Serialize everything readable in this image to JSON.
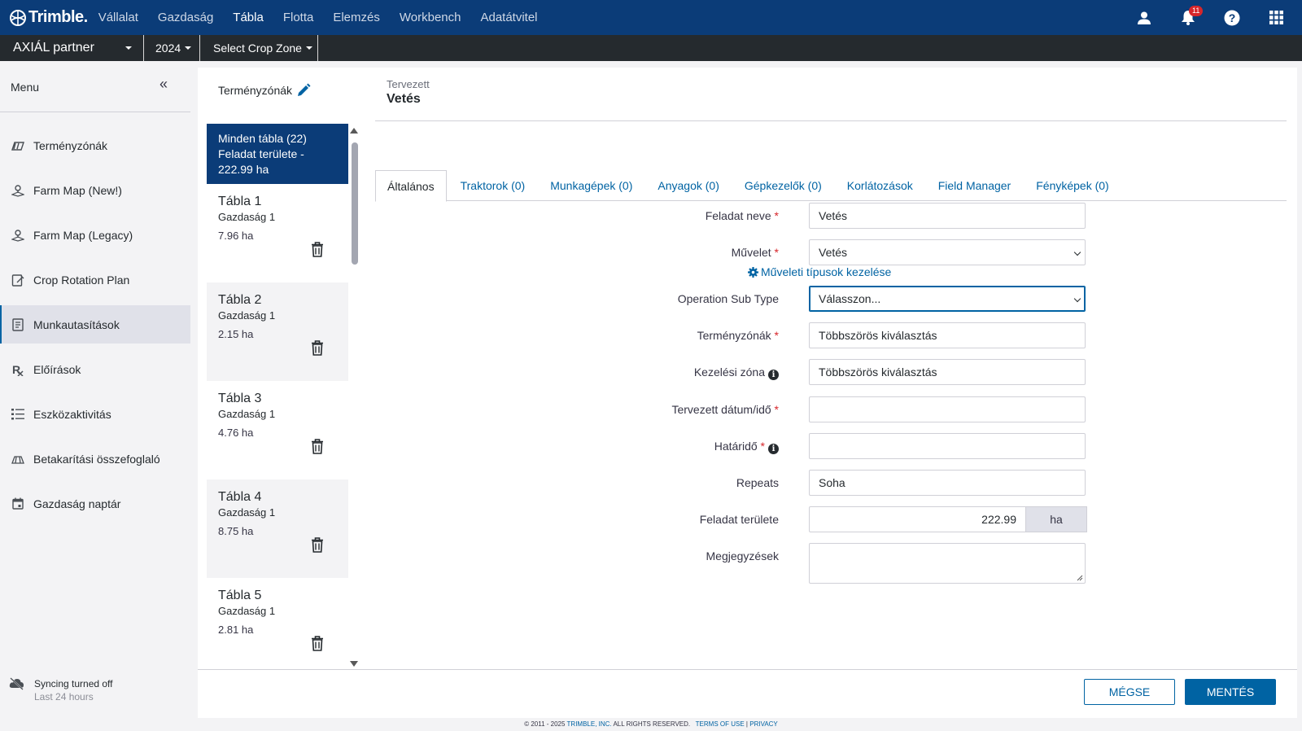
{
  "topnav": {
    "logo_text": "Trimble.",
    "items": [
      {
        "label": "Vállalat",
        "active": false
      },
      {
        "label": "Gazdaság",
        "active": false
      },
      {
        "label": "Tábla",
        "active": true
      },
      {
        "label": "Flotta",
        "active": false
      },
      {
        "label": "Elemzés",
        "active": false
      },
      {
        "label": "Workbench",
        "active": false
      },
      {
        "label": "Adatátvitel",
        "active": false
      }
    ],
    "icons": [
      "user-icon",
      "bell-icon",
      "help-icon",
      "apps-grid-icon"
    ],
    "notification_count": "11"
  },
  "subbar": {
    "partner": "AXIÁL partner",
    "year": "2024",
    "crop_zone": "Select Crop Zone"
  },
  "sidebar": {
    "menu_label": "Menu",
    "collapse_icon": "«",
    "items": [
      {
        "label": "Terményzónák",
        "icon": "crop-zones-icon"
      },
      {
        "label": "Farm Map (New!)",
        "icon": "farm-map-icon"
      },
      {
        "label": "Farm Map (Legacy)",
        "icon": "farm-map-legacy-icon"
      },
      {
        "label": "Crop Rotation Plan",
        "icon": "crop-rotation-icon"
      },
      {
        "label": "Munkautasítások",
        "icon": "work-orders-icon",
        "active": true
      },
      {
        "label": "Előírások",
        "icon": "rx-icon"
      },
      {
        "label": "Eszközaktivitás",
        "icon": "equipment-activity-icon"
      },
      {
        "label": "Betakarítási összefoglaló",
        "icon": "harvest-summary-icon"
      },
      {
        "label": "Gazdaság naptár",
        "icon": "calendar-icon"
      }
    ],
    "sync": {
      "title": "Syncing turned off",
      "subtitle": "Last 24 hours"
    }
  },
  "zones": {
    "title": "Terményzónák",
    "all": {
      "line1": "Minden tábla (22)",
      "line2": "Feladat területe - 222.99 ha"
    },
    "cards": [
      {
        "name": "Tábla 1",
        "farm": "Gazdaság 1",
        "area": "7.96 ha"
      },
      {
        "name": "Tábla 2",
        "farm": "Gazdaság 1",
        "area": "2.15 ha"
      },
      {
        "name": "Tábla 3",
        "farm": "Gazdaság 1",
        "area": "4.76 ha"
      },
      {
        "name": "Tábla 4",
        "farm": "Gazdaság 1",
        "area": "8.75 ha"
      },
      {
        "name": "Tábla 5",
        "farm": "Gazdaság 1",
        "area": "2.81 ha"
      }
    ]
  },
  "header": {
    "status": "Tervezett",
    "title": "Vetés"
  },
  "tabs": [
    {
      "label": "Általános",
      "active": true
    },
    {
      "label": "Traktorok (0)"
    },
    {
      "label": "Munkagépek (0)"
    },
    {
      "label": "Anyagok (0)"
    },
    {
      "label": "Gépkezelők (0)"
    },
    {
      "label": "Korlátozások"
    },
    {
      "label": "Field Manager"
    },
    {
      "label": "Fényképek (0)"
    }
  ],
  "form": {
    "task_name": {
      "label": "Feladat neve",
      "value": "Vetés"
    },
    "operation": {
      "label": "Művelet",
      "value": "Vetés"
    },
    "manage_link": "Műveleti típusok kezelése",
    "sub_type": {
      "label": "Operation Sub Type",
      "value": "Válasszon..."
    },
    "crop_zones": {
      "label": "Terményzónák",
      "value": "Többszörös kiválasztás"
    },
    "mgmt_zone": {
      "label": "Kezelési zóna",
      "value": "Többszörös kiválasztás"
    },
    "planned_date": {
      "label": "Tervezett dátum/idő",
      "value": ""
    },
    "deadline": {
      "label": "Határidő",
      "value": ""
    },
    "repeats": {
      "label": "Repeats",
      "value": "Soha"
    },
    "task_area": {
      "label": "Feladat területe",
      "value": "222.99",
      "unit": "ha"
    },
    "notes": {
      "label": "Megjegyzések",
      "value": ""
    }
  },
  "buttons": {
    "cancel": "MÉGSE",
    "save": "MENTÉS"
  },
  "footer": {
    "copyright": "© 2011 - 2025",
    "company": "TRIMBLE, INC.",
    "rights": "ALL RIGHTS RESERVED.",
    "terms": "TERMS OF USE",
    "sep": "|",
    "privacy": "PRIVACY"
  }
}
